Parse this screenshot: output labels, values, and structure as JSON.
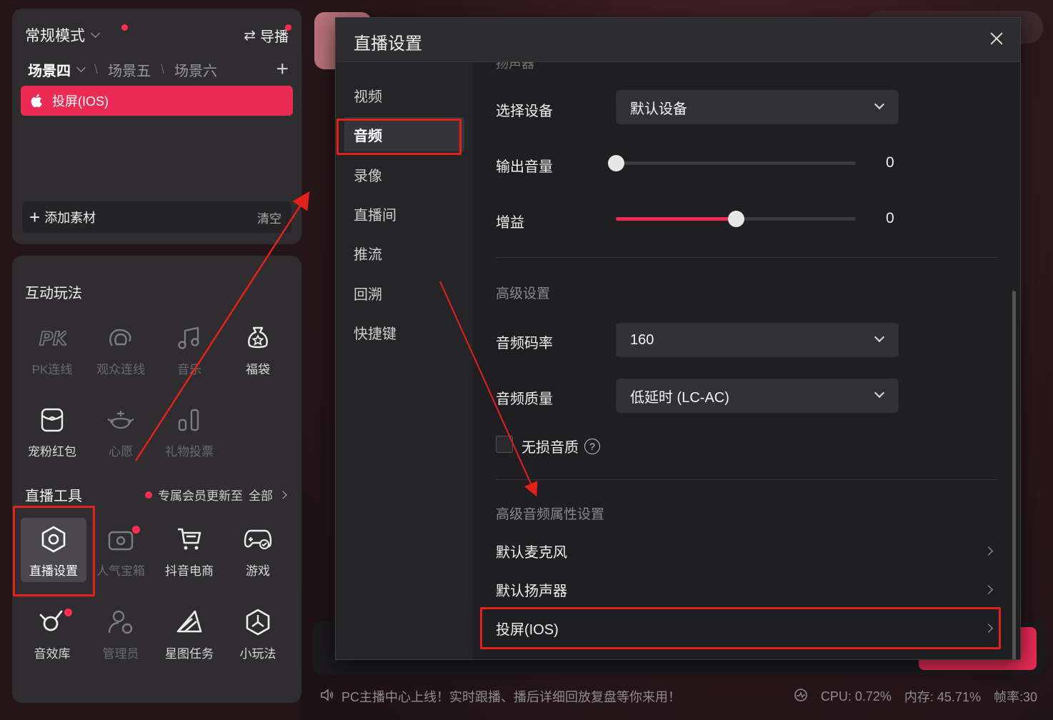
{
  "scene_panel": {
    "mode_label": "常规模式",
    "director_label": "导播",
    "scenes": [
      "场景四",
      "场景五",
      "场景六"
    ],
    "source_item": "投屏(IOS)",
    "add_source": "添加素材",
    "clear": "清空"
  },
  "interactive": {
    "title": "互动玩法",
    "items": [
      {
        "label": "PK连线",
        "icon": "pk-icon",
        "enabled": false
      },
      {
        "label": "观众连线",
        "icon": "audience-link-icon",
        "enabled": false
      },
      {
        "label": "音乐",
        "icon": "music-icon",
        "enabled": false
      },
      {
        "label": "福袋",
        "icon": "lucky-bag-icon",
        "enabled": true
      },
      {
        "label": "宠粉红包",
        "icon": "red-packet-icon",
        "enabled": true
      },
      {
        "label": "心愿",
        "icon": "wish-icon",
        "enabled": false
      },
      {
        "label": "礼物投票",
        "icon": "gift-vote-icon",
        "enabled": false
      }
    ]
  },
  "tools": {
    "title": "直播工具",
    "promo": "专属会员更新至",
    "all": "全部",
    "items": [
      {
        "label": "直播设置",
        "icon": "live-settings-icon",
        "enabled": true
      },
      {
        "label": "人气宝箱",
        "icon": "treasure-box-icon",
        "enabled": false
      },
      {
        "label": "抖音电商",
        "icon": "cart-icon",
        "enabled": true
      },
      {
        "label": "游戏",
        "icon": "gamepad-icon",
        "enabled": true
      },
      {
        "label": "音效库",
        "icon": "sound-effect-icon",
        "enabled": true
      },
      {
        "label": "管理员",
        "icon": "admin-icon",
        "enabled": false
      },
      {
        "label": "星图任务",
        "icon": "star-task-icon",
        "enabled": true
      },
      {
        "label": "小玩法",
        "icon": "mini-game-icon",
        "enabled": true
      }
    ]
  },
  "status": {
    "message": "PC主播中心上线！实时跟播、播后详细回放复盘等你来用！",
    "cpu": "CPU: 0.72%",
    "memory": "内存: 45.71%",
    "fps": "帧率:30"
  },
  "dialog": {
    "title": "直播设置",
    "nav": [
      "视频",
      "音频",
      "录像",
      "直播间",
      "推流",
      "回溯",
      "快捷键"
    ],
    "active_nav": "音频",
    "cut_heading": "扬声器",
    "device_label": "选择设备",
    "device_value": "默认设备",
    "volume_label": "输出音量",
    "volume_value": "0",
    "volume_level": 0,
    "gain_label": "增益",
    "gain_value": "0",
    "gain_level": 0.5,
    "advanced_title": "高级设置",
    "bitrate_label": "音频码率",
    "bitrate_value": "160",
    "quality_label": "音频质量",
    "quality_value": "低延时 (LC-AC)",
    "lossless_label": "无损音质",
    "audio_props_title": "高级音频属性设置",
    "links": [
      "默认麦克风",
      "默认扬声器",
      "投屏(IOS)"
    ]
  },
  "colors": {
    "accent": "#ec2b55",
    "highlight": "#e3211b",
    "panel": "#2f2d30",
    "dialog_bg": "#1f1e21"
  }
}
